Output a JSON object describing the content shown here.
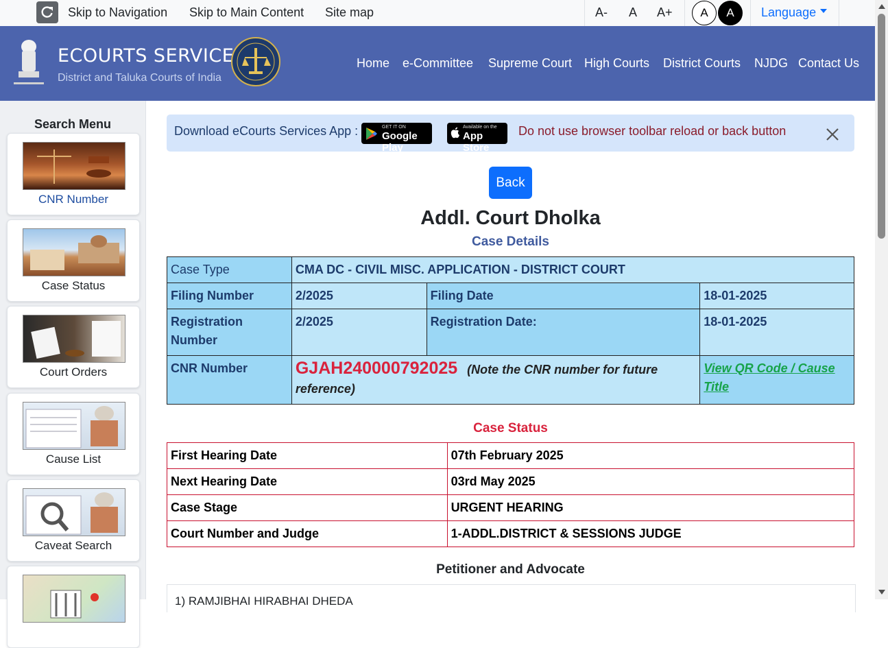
{
  "topbar": {
    "skip_navigation": "Skip to Navigation",
    "skip_main": "Skip to Main Content",
    "site_map": "Site map",
    "font_decrease": "A-",
    "font_normal": "A",
    "font_increase": "A+",
    "contrast_light": "A",
    "contrast_dark": "A",
    "language": "Language"
  },
  "header": {
    "brand_title": "ECOURTS SERVICES",
    "brand_subtitle": "District and Taluka Courts of India",
    "nav": [
      "Home",
      "e-Committee",
      "Supreme Court",
      "High Courts",
      "District Courts",
      "NJDG",
      "Contact Us"
    ],
    "color": "#4c64ad"
  },
  "sidebar": {
    "title": "Search Menu",
    "items": [
      {
        "label": "CNR Number",
        "icon": "court-gavel-image"
      },
      {
        "label": "Case Status",
        "icon": "supreme-court-image"
      },
      {
        "label": "Court Orders",
        "icon": "court-orders-image"
      },
      {
        "label": "Cause List",
        "icon": "cause-list-image"
      },
      {
        "label": "Caveat Search",
        "icon": "caveat-search-image"
      },
      {
        "label": "",
        "icon": "map-image"
      }
    ]
  },
  "banner": {
    "download_text": "Download eCourts Services App :",
    "google_play_small": "GET IT ON",
    "google_play": "Google Play",
    "app_store_small": "Available on the",
    "app_store": "App Store",
    "warning": "Do not use browser toolbar reload or back button"
  },
  "main": {
    "back_label": "Back",
    "court_name": "Addl. Court Dholka",
    "case_details_heading": "Case Details",
    "case_status_heading": "Case Status",
    "petitioner_heading": "Petitioner and Advocate",
    "petitioner_first": "1) RAMJIBHAI HIRABHAI DHEDA"
  },
  "case_details": {
    "case_type_label": "Case Type",
    "case_type_value": "CMA DC - CIVIL MISC. APPLICATION - DISTRICT COURT",
    "filing_number_label": "Filing Number",
    "filing_number_value": "2/2025",
    "filing_date_label": "Filing Date",
    "filing_date_value": "18-01-2025",
    "registration_number_label": "Registration Number",
    "registration_number_value": "2/2025",
    "registration_date_label": "Registration Date:",
    "registration_date_value": "18-01-2025",
    "cnr_label": "CNR Number",
    "cnr_value": "GJAH240000792025",
    "cnr_note": "(Note the CNR number for future reference)",
    "qr_link": "View QR Code / Cause Title"
  },
  "case_status": [
    {
      "label": "First Hearing Date",
      "value": "07th February 2025"
    },
    {
      "label": "Next Hearing Date",
      "value": "03rd May 2025"
    },
    {
      "label": "Case Stage",
      "value": "URGENT HEARING"
    },
    {
      "label": "Court Number and Judge",
      "value": "1-ADDL.DISTRICT & SESSIONS JUDGE"
    }
  ]
}
